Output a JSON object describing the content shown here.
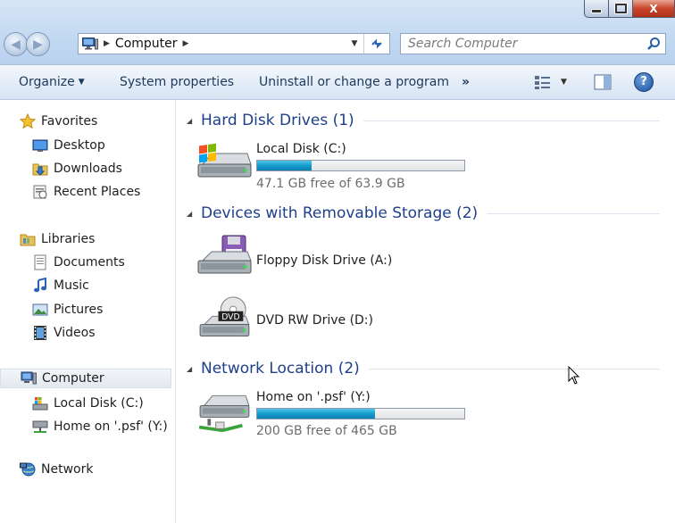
{
  "window": {
    "controls": {
      "close_label": "X"
    }
  },
  "nav": {
    "back_glyph": "◀",
    "forward_glyph": "▶",
    "address": {
      "crumb": "Computer"
    },
    "search": {
      "placeholder": "Search Computer"
    }
  },
  "commands": {
    "organize": "Organize",
    "system_properties": "System properties",
    "uninstall": "Uninstall or change a program",
    "more": "»",
    "help": "?"
  },
  "sidebar": {
    "favorites": {
      "label": "Favorites",
      "items": [
        "Desktop",
        "Downloads",
        "Recent Places"
      ]
    },
    "libraries": {
      "label": "Libraries",
      "items": [
        "Documents",
        "Music",
        "Pictures",
        "Videos"
      ]
    },
    "computer": {
      "label": "Computer",
      "items": [
        "Local Disk (C:)",
        "Home on '.psf' (Y:)"
      ]
    },
    "network": {
      "label": "Network"
    }
  },
  "groups": {
    "hdd": {
      "title": "Hard Disk Drives (1)",
      "drives": [
        {
          "name": "Local Disk (C:)",
          "free_text": "47.1 GB free of 63.9 GB",
          "used_fraction": 0.263
        }
      ]
    },
    "removable": {
      "title": "Devices with Removable Storage (2)",
      "drives": [
        {
          "name": "Floppy Disk Drive (A:)"
        },
        {
          "name": "DVD RW Drive (D:)",
          "badge": "DVD"
        }
      ]
    },
    "network": {
      "title": "Network Location (2)",
      "drives": [
        {
          "name": "Home on '.psf' (Y:)",
          "free_text": "200 GB free of 465 GB",
          "used_fraction": 0.57
        }
      ]
    }
  },
  "colors": {
    "group_title": "#1e3f8a",
    "bar_fill": "#1aa0cf",
    "free_text": "#6d6d6d"
  }
}
